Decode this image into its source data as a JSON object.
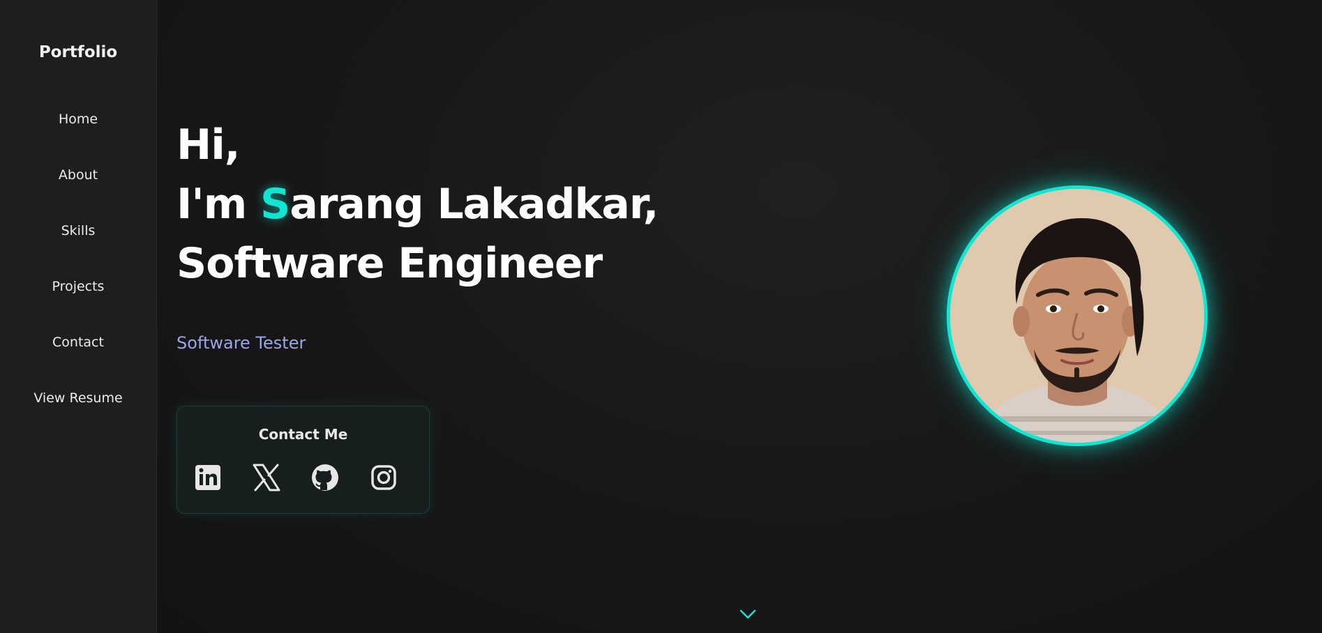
{
  "sidebar": {
    "brand": "Portfolio",
    "items": [
      {
        "label": "Home"
      },
      {
        "label": "About"
      },
      {
        "label": "Skills"
      },
      {
        "label": "Projects"
      },
      {
        "label": "Contact"
      },
      {
        "label": "View Resume"
      }
    ]
  },
  "hero": {
    "line1": "Hi,",
    "line2_prefix": "I'm ",
    "line2_accent": "S",
    "line2_rest": "arang Lakadkar,",
    "line3": "Software Engineer",
    "subtitle": "Software Tester"
  },
  "contact": {
    "title": "Contact Me",
    "icons": [
      "linkedin-icon",
      "x-twitter-icon",
      "github-icon",
      "instagram-icon"
    ]
  },
  "colors": {
    "accent": "#12e5d2",
    "subtitle": "#9aa6e6",
    "background": "#151515",
    "sidebar": "#1e1e1e"
  }
}
